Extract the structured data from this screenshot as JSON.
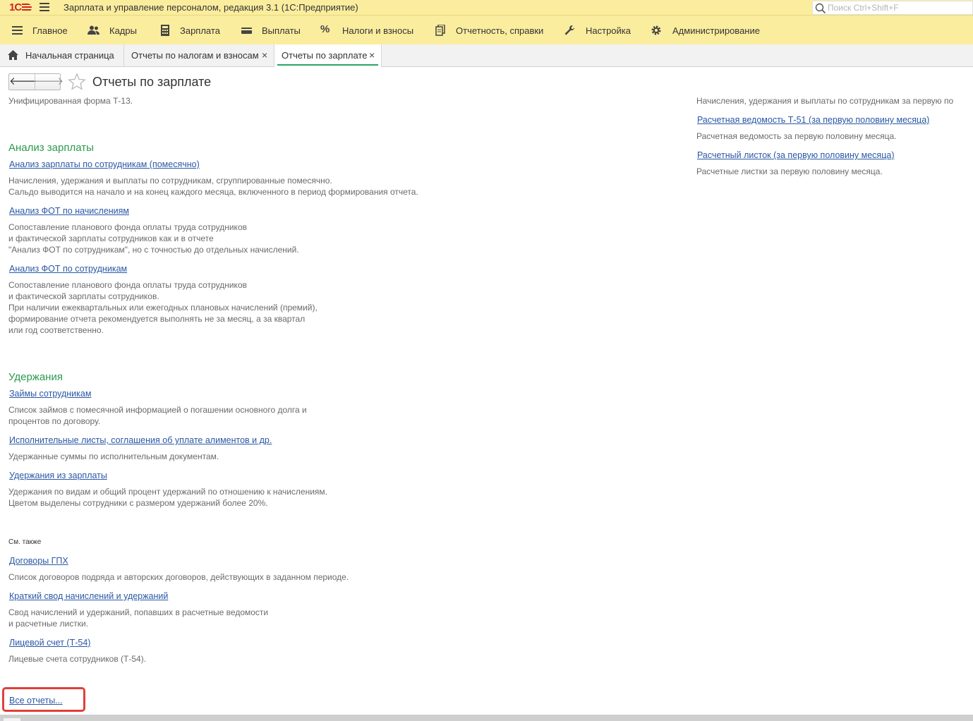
{
  "app": {
    "logo": "1С",
    "title": "Зарплата и управление персоналом, редакция 3.1  (1С:Предприятие)",
    "search_placeholder": "Поиск Ctrl+Shift+F"
  },
  "sections": [
    {
      "label": "Главное",
      "icon": "menu-lines-icon"
    },
    {
      "label": "Кадры",
      "icon": "people-icon"
    },
    {
      "label": "Зарплата",
      "icon": "calculator-icon"
    },
    {
      "label": "Выплаты",
      "icon": "wallet-icon"
    },
    {
      "label": "Налоги и взносы",
      "icon": "percent-icon"
    },
    {
      "label": "Отчетность, справки",
      "icon": "documents-icon"
    },
    {
      "label": "Настройка",
      "icon": "wrench-icon"
    },
    {
      "label": "Администрирование",
      "icon": "gear-icon"
    }
  ],
  "tabs": [
    {
      "label": "Начальная страница",
      "icon": "home-icon"
    },
    {
      "label": "Отчеты по налогам и взносам",
      "close": "×"
    },
    {
      "label": "Отчеты по зарплате",
      "close": "×",
      "active": true
    }
  ],
  "form": {
    "title": "Отчеты по зарплате",
    "back": "🡐",
    "forward": "🡒"
  },
  "left": {
    "top_desc": "Унифицированная форма Т-13.",
    "analysis": {
      "title": "Анализ зарплаты",
      "items": [
        {
          "link": "Анализ зарплаты по сотрудникам (помесячно)",
          "desc": [
            "Начисления, удержания и выплаты по сотрудникам, сгруппированные помесячно.",
            "Сальдо выводится на начало и на конец каждого месяца, включенного в период формирования отчета."
          ]
        },
        {
          "link": "Анализ ФОТ по начислениям",
          "desc": [
            "Сопоставление планового фонда оплаты труда сотрудников",
            "и фактической зарплаты сотрудников как и в отчете",
            "\"Анализ ФОТ по сотрудникам\", но с точностью до отдельных начислений."
          ]
        },
        {
          "link": "Анализ ФОТ по сотрудникам",
          "desc": [
            "Сопоставление планового фонда оплаты труда сотрудников",
            "и фактической зарплаты сотрудников.",
            "При наличии ежеквартальных или ежегодных плановых начислений (премий),",
            "формирование отчета рекомендуется выполнять не за месяц, а за квартал",
            "или год соответственно."
          ]
        }
      ]
    },
    "deductions": {
      "title": "Удержания",
      "items": [
        {
          "link": "Займы сотрудникам",
          "desc": [
            "Список займов с помесячной информацией о погашении основного долга и",
            "процентов по договору."
          ]
        },
        {
          "link": "Исполнительные листы, соглашения об уплате алиментов и др.",
          "desc": [
            "Удержанные суммы по исполнительным документам."
          ]
        },
        {
          "link": "Удержания из зарплаты",
          "desc": [
            "Удержания по видам и общий процент удержаний по отношению к начислениям.",
            "Цветом выделены сотрудники с размером удержаний более 20%."
          ]
        }
      ]
    },
    "see_also": {
      "title": "См. также",
      "items": [
        {
          "link": "Договоры ГПХ",
          "desc": [
            "Список договоров подряда и авторских договоров, действующих в заданном периоде."
          ]
        },
        {
          "link": "Краткий свод начислений и удержаний",
          "desc": [
            "Свод начислений и удержаний, попавших в расчетные ведомости",
            "и расчетные листки."
          ]
        },
        {
          "link": "Лицевой счет (Т-54)",
          "desc": [
            "Лицевые счета сотрудников (Т-54)."
          ]
        }
      ]
    },
    "all_reports": "Все отчеты..."
  },
  "right": {
    "top_desc": "Начисления, удержания и выплаты по сотрудникам за первую по",
    "items": [
      {
        "link": "Расчетная ведомость Т-51 (за первую половину месяца)",
        "desc": "Расчетная ведомость за первую половину месяца."
      },
      {
        "link": "Расчетный листок (за первую половину месяца)",
        "desc": "Расчетные листки за первую половину месяца."
      }
    ]
  },
  "colors": {
    "panel": "#fbed9e",
    "group_title": "#2b9a4d",
    "link": "#2a58a6",
    "highlight": "#e0403a"
  }
}
